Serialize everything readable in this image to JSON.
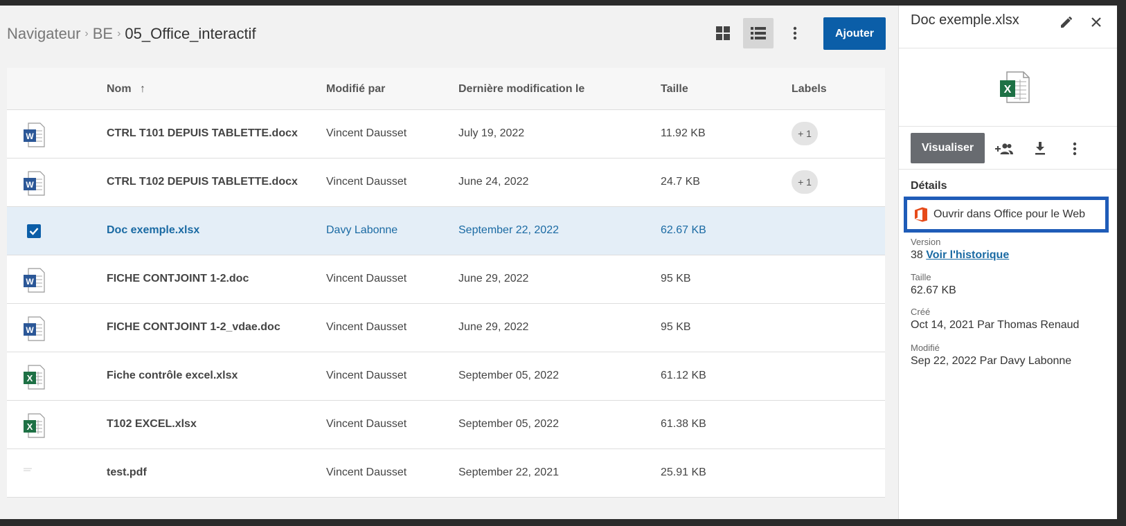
{
  "breadcrumb": {
    "items": [
      "Navigateur",
      "BE"
    ],
    "current": "05_Office_interactif"
  },
  "toolbar": {
    "grid_icon": "grid-view-icon",
    "list_icon": "list-view-icon",
    "more_icon": "more-vertical-icon",
    "add_label": "Ajouter"
  },
  "table": {
    "columns": {
      "name": "Nom",
      "modified_by": "Modifié par",
      "modified_on": "Dernière modification le",
      "size": "Taille",
      "labels": "Labels"
    },
    "rows": [
      {
        "type": "word",
        "name": "CTRL T101 DEPUIS TABLETTE.docx",
        "modified_by": "Vincent Dausset",
        "date": "July 19, 2022",
        "size": "11.92 KB",
        "label": "+ 1"
      },
      {
        "type": "word",
        "name": "CTRL T102 DEPUIS TABLETTE.docx",
        "modified_by": "Vincent Dausset",
        "date": "June 24, 2022",
        "size": "24.7 KB",
        "label": "+ 1"
      },
      {
        "type": "excel",
        "name": "Doc exemple.xlsx",
        "modified_by": "Davy Labonne",
        "date": "September 22, 2022",
        "size": "62.67 KB",
        "label": "",
        "selected": true
      },
      {
        "type": "word",
        "name": "FICHE CONTJOINT 1-2.doc",
        "modified_by": "Vincent Dausset",
        "date": "June 29, 2022",
        "size": "95 KB",
        "label": ""
      },
      {
        "type": "word",
        "name": "FICHE CONTJOINT 1-2_vdae.doc",
        "modified_by": "Vincent Dausset",
        "date": "June 29, 2022",
        "size": "95 KB",
        "label": ""
      },
      {
        "type": "excel",
        "name": "Fiche contrôle excel.xlsx",
        "modified_by": "Vincent Dausset",
        "date": "September 05, 2022",
        "size": "61.12 KB",
        "label": ""
      },
      {
        "type": "excel",
        "name": "T102 EXCEL.xlsx",
        "modified_by": "Vincent Dausset",
        "date": "September 05, 2022",
        "size": "61.38 KB",
        "label": ""
      },
      {
        "type": "pdf",
        "name": "test.pdf",
        "modified_by": "Vincent Dausset",
        "date": "September 22, 2021",
        "size": "25.91 KB",
        "label": ""
      }
    ]
  },
  "panel": {
    "title": "Doc exemple.xlsx",
    "view_label": "Visualiser",
    "details_label": "Détails",
    "office_label": "Ouvrir dans Office pour le Web",
    "version_label": "Version",
    "version_number": "38",
    "history_link": "Voir l'historique",
    "size_label": "Taille",
    "size_value": "62.67 KB",
    "created_label": "Créé",
    "created_value": "Oct 14, 2021 Par Thomas Renaud",
    "modified_label": "Modifié",
    "modified_value": "Sep 22, 2022 Par Davy Labonne"
  },
  "colors": {
    "accent": "#0b5ea8",
    "selected_row": "#e4eef7",
    "word": "#2b5797",
    "excel": "#1e7145",
    "office": "#e64a19",
    "highlight_box": "#1f5cb8"
  }
}
